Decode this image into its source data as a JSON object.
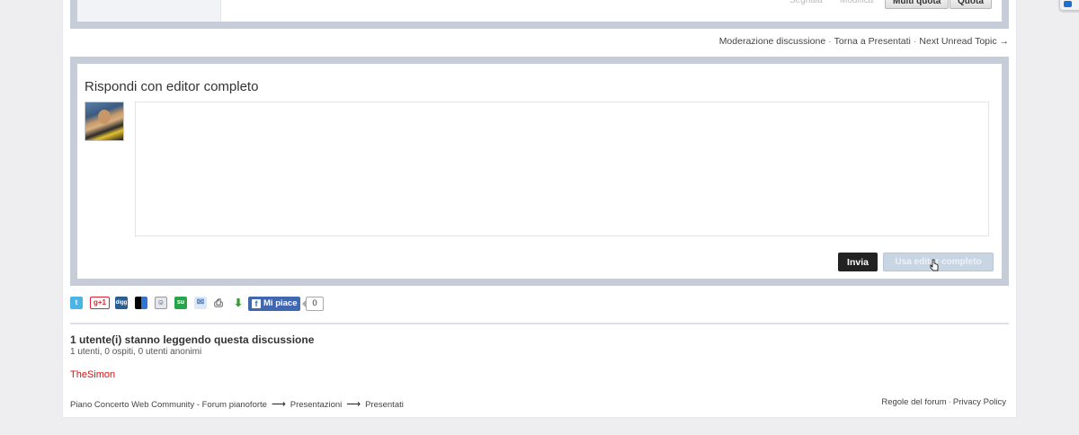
{
  "previous_post": {
    "buttons": {
      "segnala": "Segnala",
      "modifica": "Modifica",
      "multi_quota": "Multi quota",
      "quota": "Quota"
    }
  },
  "topic_nav": {
    "moderation": "Moderazione discussione",
    "back": "Torna a Presentati",
    "next": "Next Unread Topic →"
  },
  "reply": {
    "title": "Rispondi con editor completo",
    "editor_value": "",
    "send_label": "Invia",
    "full_editor_label": "Usa editor completo"
  },
  "share": {
    "icons": [
      "twitter-icon",
      "google-plus-icon",
      "digg-icon",
      "delicious-icon",
      "reddit-icon",
      "stumbleupon-icon",
      "email-icon",
      "print-icon",
      "download-icon"
    ],
    "google_plus_label": "g+1",
    "digg_label": "digg",
    "stumble_label": "su",
    "fb_like_label": "Mi piace",
    "fb_like_count": "0"
  },
  "viewers": {
    "title": "1 utente(i) stanno leggendo questa discussione",
    "subtitle": "1 utenti, 0 ospiti, 0 utenti anonimi",
    "users": [
      "TheSimon"
    ]
  },
  "breadcrumb": {
    "items": [
      "Piano Concerto Web Community - Forum pianoforte",
      "Presentazioni",
      "Presentati"
    ],
    "arrow": "⟶"
  },
  "footer": {
    "rules": "Regole del forum",
    "privacy": "Privacy Policy"
  },
  "colors": {
    "frame": "#c7ccd9",
    "user_link": "#dd1111",
    "send_button": "#222222",
    "facebook": "#4267b2"
  }
}
